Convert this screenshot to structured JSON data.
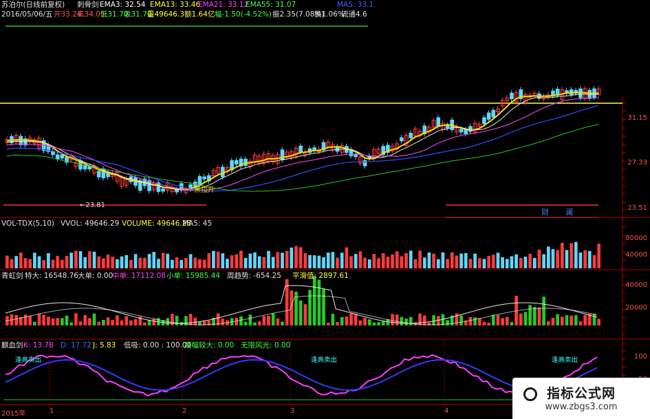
{
  "colors": {
    "up": "#ff3b3b",
    "down": "#5fd7ff",
    "ma_yellow": "#ffd700",
    "ma_white": "#e8e8e8",
    "ma_magenta": "#e040e0",
    "ma_blue": "#3050ff",
    "ma_green": "#30c030",
    "panel_border": "#b00000",
    "vol_green": "#22cc22",
    "kdj_magenta": "#ff40ff",
    "kdj_blue": "#3838ff"
  },
  "header": {
    "stock": "苏泊尔(日线前复权)",
    "indicator_name": "刺骨剑",
    "ema3": "EMA3: 32.54",
    "ema13": "EMA13: 33.46",
    "ema21": "EMA21: 33.12",
    "ema55": "EMA55: 31.07",
    "ma5": "MA5: 33.1"
  },
  "info_bar": {
    "date": "2016/05/06/五",
    "open": "开33.24",
    "high": "高34.05",
    "low": "低31.70",
    "close": "收31.70",
    "volume": "量49646.3",
    "amount": "额1.64亿",
    "change": "幅-1.50(-4.52%)",
    "swing": "振2.35(7.08%)",
    "turnover": "换1.06%",
    "float": "流通4.6"
  },
  "main_panel": {
    "price_labels": [
      "31.15",
      "27.33",
      "23.51"
    ],
    "low_marker": "←23.81",
    "annotations": {
      "label_1": "黑拉升",
      "caifu": "财",
      "lan": "澜"
    }
  },
  "volume_panel": {
    "title": "VOL-TDX(5,10)",
    "vvol": "VVOL: 49646.29",
    "volume": "VOLUME: 49646.28",
    "ma5": "MA5: 45",
    "axis": [
      "80000",
      "40000"
    ]
  },
  "flow_panel": {
    "title": "青虹剑",
    "tedadan": "特大: 16548.76",
    "dadan": "大单: 0.00",
    "zhongdan": "中单: 17112.08",
    "xiaodan": "小单: 15985.44",
    "zhoushi": "周趋势: -654.25",
    "pinghua": "平滑值: 2897.61",
    "axis": [
      "40000",
      "20000"
    ]
  },
  "kdj_panel": {
    "title": "麒血剑",
    "k": "K: 13.78",
    "d": "D: 17.72",
    "j": "J: 5.83",
    "dizhi": "低吸: 0.00 : 100.00",
    "tiefu": "跌幅较大: 0.00",
    "wuxian": "无限风光: 0.00",
    "signal": "逢高卖出",
    "axis": [
      "100",
      "50"
    ]
  },
  "x_axis": {
    "year": "2015年",
    "months": [
      "1",
      "2",
      "3",
      "4"
    ]
  },
  "watermark": {
    "title": "指标公式网",
    "url": "www.zbgs3.com"
  }
}
